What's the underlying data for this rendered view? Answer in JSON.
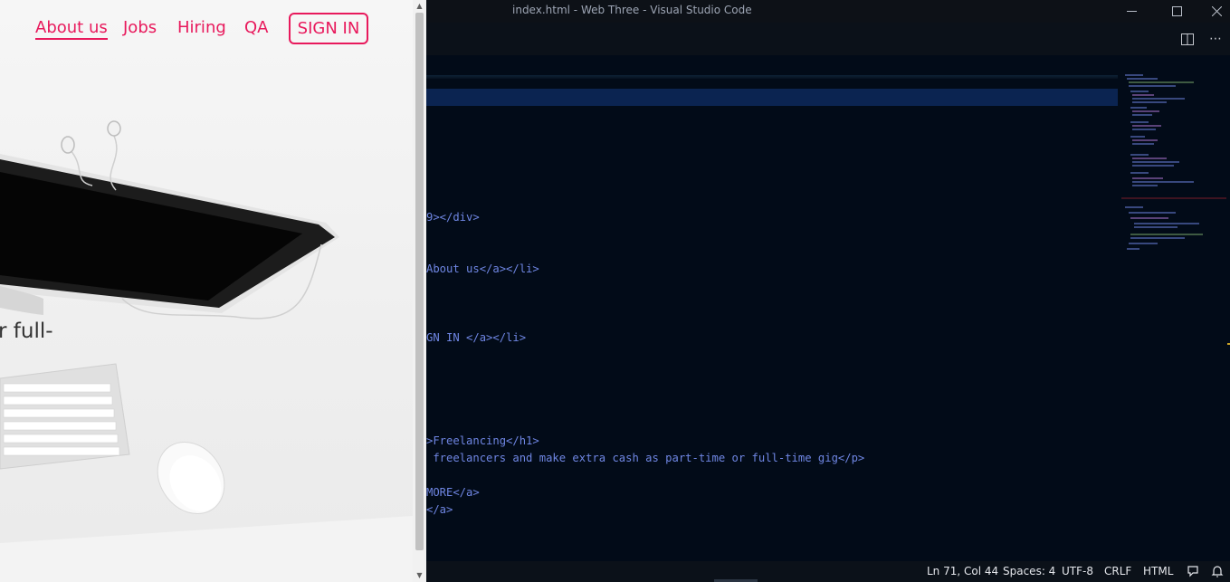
{
  "browser": {
    "nav": {
      "about": "About us",
      "jobs": "Jobs",
      "hiring": "Hiring",
      "qa": "QA",
      "signin": "SIGN IN"
    },
    "hero_fragment": "r full-"
  },
  "window": {
    "title": "index.html - Web Three - Visual Studio Code",
    "minimize_icon": "minimize-icon",
    "maximize_icon": "maximize-icon",
    "close_icon": "close-icon"
  },
  "editor": {
    "lines": [
      {
        "text": "9></div>"
      },
      {
        "text": "About us</a></li>"
      },
      {
        "text": "GN IN </a></li>"
      },
      {
        "text": ">Freelancing</h1>"
      },
      {
        "text": " freelancers and make extra cash as part-time or full-time gig</p>"
      },
      {
        "text": "MORE</a>"
      },
      {
        "text": "</a>"
      }
    ]
  },
  "status": {
    "position": "Ln 71, Col 44",
    "spaces": "Spaces: 4",
    "encoding": "UTF-8",
    "eol": "CRLF",
    "language": "HTML"
  },
  "colors": {
    "accent": "#e8195c",
    "editor_bg": "#020b18",
    "code_text": "#6f86e3"
  }
}
